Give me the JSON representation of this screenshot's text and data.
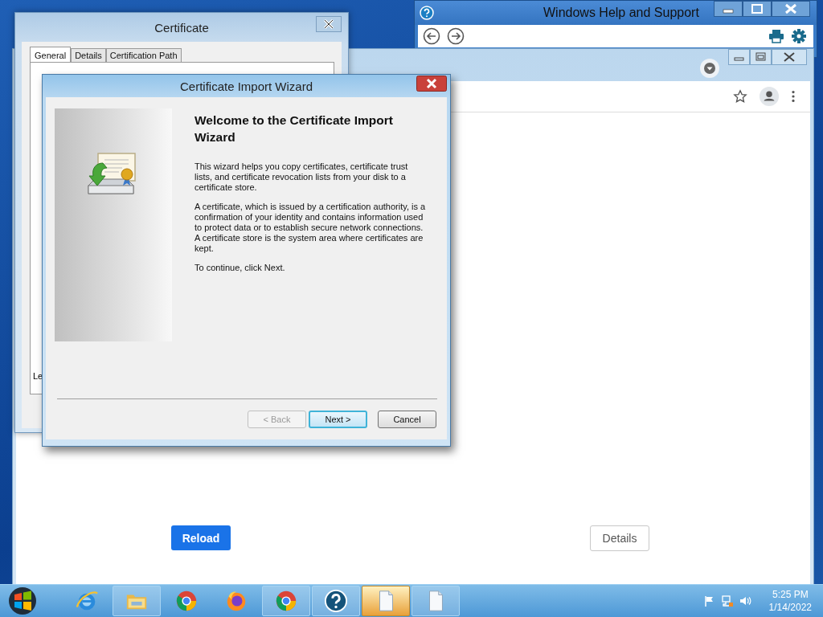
{
  "help_window": {
    "title": "Windows Help and Support"
  },
  "browser_window": {
    "buttons": [
      {
        "label": "Reload",
        "kind": "primary"
      },
      {
        "label": "Details",
        "kind": "secondary"
      }
    ]
  },
  "certificate_window": {
    "title": "Certificate",
    "tabs": [
      {
        "label": "General",
        "selected": true
      },
      {
        "label": "Details",
        "selected": false
      },
      {
        "label": "Certification Path",
        "selected": false
      }
    ],
    "partial_text": "Le"
  },
  "wizard": {
    "title": "Certificate Import Wizard",
    "heading": "Welcome to the Certificate Import Wizard",
    "paragraphs": [
      "This wizard helps you copy certificates, certificate trust lists, and certificate revocation lists from your disk to a certificate store.",
      "A certificate, which is issued by a certification authority, is a confirmation of your identity and contains information used to protect data or to establish secure network connections. A certificate store is the system area where certificates are kept.",
      "To continue, click Next."
    ],
    "buttons": [
      {
        "label": "< Back",
        "disabled": true,
        "focused": false
      },
      {
        "label": "Next >",
        "disabled": false,
        "focused": true
      },
      {
        "label": "Cancel",
        "disabled": false,
        "focused": false
      }
    ]
  },
  "taskbar": {
    "items": [
      {
        "kind": "ie",
        "running": false,
        "selected": false
      },
      {
        "kind": "explorer",
        "running": true,
        "selected": false
      },
      {
        "kind": "chrome",
        "running": false,
        "selected": false
      },
      {
        "kind": "firefox",
        "running": false,
        "selected": false
      },
      {
        "kind": "chrome",
        "running": true,
        "selected": false
      },
      {
        "kind": "help",
        "running": true,
        "selected": false
      },
      {
        "kind": "document",
        "running": true,
        "selected": true
      },
      {
        "kind": "document",
        "running": true,
        "selected": false
      }
    ],
    "time": "5:25 PM",
    "date": "1/14/2022"
  }
}
